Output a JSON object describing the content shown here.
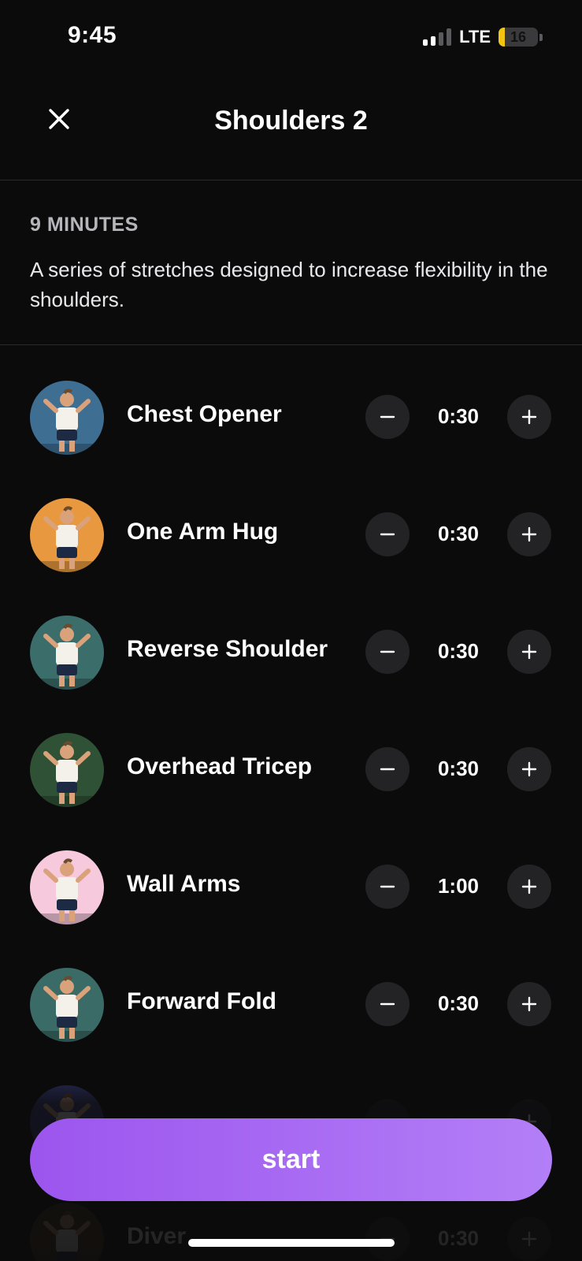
{
  "status_bar": {
    "time": "9:45",
    "network": "LTE",
    "battery": "16",
    "battery_level_percent": 16,
    "signal_bars_active": 2,
    "signal_bars_total": 4
  },
  "header": {
    "title": "Shoulders 2",
    "close_icon": "close-icon"
  },
  "summary": {
    "duration": "9 MINUTES",
    "description": "A series of stretches designed to increase flexibility in the shoulders."
  },
  "exercises": [
    {
      "name": "Chest Opener",
      "duration": "0:30",
      "thumb_color": "#3f6e93"
    },
    {
      "name": "One Arm Hug",
      "duration": "0:30",
      "thumb_color": "#e8983f"
    },
    {
      "name": "Reverse Shoulder",
      "duration": "0:30",
      "thumb_color": "#3b6d6a"
    },
    {
      "name": "Overhead Tricep",
      "duration": "0:30",
      "thumb_color": "#2f5236"
    },
    {
      "name": "Wall Arms",
      "duration": "1:00",
      "thumb_color": "#f6c9dd"
    },
    {
      "name": "Forward Fold",
      "duration": "0:30",
      "thumb_color": "#3a6b66"
    },
    {
      "name": "",
      "duration": "",
      "thumb_color": "#3b3f86"
    },
    {
      "name": "Diver",
      "duration": "0:30",
      "thumb_color": "#4a3418"
    }
  ],
  "controls": {
    "minus_icon": "minus-icon",
    "plus_icon": "plus-icon"
  },
  "start_button": {
    "label": "start",
    "gradient_start": "#9c55ee",
    "gradient_end": "#b37ff7"
  }
}
